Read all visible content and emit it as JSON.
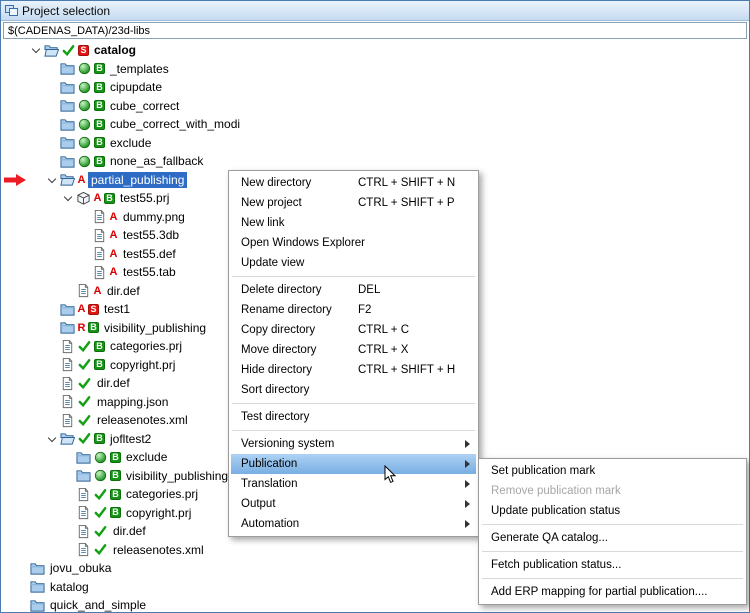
{
  "window": {
    "title": "Project selection",
    "path": "$(CADENAS_DATA)/23d-libs"
  },
  "tree": {
    "items": [
      {
        "depth": 0,
        "expander": "open",
        "bold": true,
        "icons": [
          {
            "t": "folder-open"
          },
          {
            "t": "check"
          },
          {
            "t": "badge",
            "letter": "S",
            "color": "red"
          }
        ],
        "label": "catalog"
      },
      {
        "depth": 1,
        "icons": [
          {
            "t": "folder"
          },
          {
            "t": "orb"
          },
          {
            "t": "badge",
            "letter": "B",
            "color": "green"
          }
        ],
        "label": "_templates"
      },
      {
        "depth": 1,
        "icons": [
          {
            "t": "folder"
          },
          {
            "t": "orb"
          },
          {
            "t": "badge",
            "letter": "B",
            "color": "green"
          }
        ],
        "label": "cipupdate"
      },
      {
        "depth": 1,
        "icons": [
          {
            "t": "folder"
          },
          {
            "t": "orb"
          },
          {
            "t": "badge",
            "letter": "B",
            "color": "green"
          }
        ],
        "label": "cube_correct"
      },
      {
        "depth": 1,
        "icons": [
          {
            "t": "folder"
          },
          {
            "t": "orb"
          },
          {
            "t": "badge",
            "letter": "B",
            "color": "green"
          }
        ],
        "label": "cube_correct_with_modi"
      },
      {
        "depth": 1,
        "icons": [
          {
            "t": "folder"
          },
          {
            "t": "orb"
          },
          {
            "t": "badge",
            "letter": "B",
            "color": "green"
          }
        ],
        "label": "exclude"
      },
      {
        "depth": 1,
        "icons": [
          {
            "t": "folder"
          },
          {
            "t": "orb"
          },
          {
            "t": "badge",
            "letter": "B",
            "color": "green"
          }
        ],
        "label": "none_as_fallback"
      },
      {
        "depth": 1,
        "expander": "open",
        "selected": true,
        "icons": [
          {
            "t": "folder-open"
          },
          {
            "t": "letter",
            "letter": "A"
          }
        ],
        "label": "partial_publishing"
      },
      {
        "depth": 2,
        "expander": "open",
        "icons": [
          {
            "t": "project"
          },
          {
            "t": "letter",
            "letter": "A"
          },
          {
            "t": "badge",
            "letter": "B",
            "color": "green"
          }
        ],
        "label": "test55.prj"
      },
      {
        "depth": 3,
        "icons": [
          {
            "t": "file"
          },
          {
            "t": "letter",
            "letter": "A"
          }
        ],
        "label": "dummy.png"
      },
      {
        "depth": 3,
        "icons": [
          {
            "t": "file"
          },
          {
            "t": "letter",
            "letter": "A"
          }
        ],
        "label": "test55.3db"
      },
      {
        "depth": 3,
        "icons": [
          {
            "t": "file"
          },
          {
            "t": "letter",
            "letter": "A"
          }
        ],
        "label": "test55.def"
      },
      {
        "depth": 3,
        "icons": [
          {
            "t": "file"
          },
          {
            "t": "letter",
            "letter": "A"
          }
        ],
        "label": "test55.tab"
      },
      {
        "depth": 2,
        "icons": [
          {
            "t": "file"
          },
          {
            "t": "letter",
            "letter": "A"
          }
        ],
        "label": "dir.def"
      },
      {
        "depth": 1,
        "icons": [
          {
            "t": "folder"
          },
          {
            "t": "letter",
            "letter": "A"
          },
          {
            "t": "badge",
            "letter": "S",
            "color": "red"
          }
        ],
        "label": "test1"
      },
      {
        "depth": 1,
        "icons": [
          {
            "t": "folder"
          },
          {
            "t": "letter",
            "letter": "R"
          },
          {
            "t": "badge",
            "letter": "B",
            "color": "green"
          }
        ],
        "label": "visibility_publishing"
      },
      {
        "depth": 1,
        "icons": [
          {
            "t": "file"
          },
          {
            "t": "check"
          },
          {
            "t": "badge",
            "letter": "B",
            "color": "green"
          }
        ],
        "label": "categories.prj"
      },
      {
        "depth": 1,
        "icons": [
          {
            "t": "file"
          },
          {
            "t": "check"
          },
          {
            "t": "badge",
            "letter": "B",
            "color": "green"
          }
        ],
        "label": "copyright.prj"
      },
      {
        "depth": 1,
        "icons": [
          {
            "t": "file"
          },
          {
            "t": "check"
          }
        ],
        "label": "dir.def"
      },
      {
        "depth": 1,
        "icons": [
          {
            "t": "file"
          },
          {
            "t": "check"
          }
        ],
        "label": "mapping.json"
      },
      {
        "depth": 1,
        "icons": [
          {
            "t": "file"
          },
          {
            "t": "check"
          }
        ],
        "label": "releasenotes.xml"
      },
      {
        "depth": 1,
        "expander": "open",
        "icons": [
          {
            "t": "folder-open"
          },
          {
            "t": "check"
          },
          {
            "t": "badge",
            "letter": "B",
            "color": "green"
          }
        ],
        "label": "jofltest2"
      },
      {
        "depth": 2,
        "icons": [
          {
            "t": "folder"
          },
          {
            "t": "orb"
          },
          {
            "t": "badge",
            "letter": "B",
            "color": "green"
          }
        ],
        "label": "exclude"
      },
      {
        "depth": 2,
        "icons": [
          {
            "t": "folder"
          },
          {
            "t": "orb"
          },
          {
            "t": "badge",
            "letter": "B",
            "color": "green"
          }
        ],
        "label": "visibility_publishing"
      },
      {
        "depth": 2,
        "icons": [
          {
            "t": "file"
          },
          {
            "t": "check"
          },
          {
            "t": "badge",
            "letter": "B",
            "color": "green"
          }
        ],
        "label": "categories.prj"
      },
      {
        "depth": 2,
        "icons": [
          {
            "t": "file"
          },
          {
            "t": "check"
          },
          {
            "t": "badge",
            "letter": "B",
            "color": "green"
          }
        ],
        "label": "copyright.prj"
      },
      {
        "depth": 2,
        "icons": [
          {
            "t": "file"
          },
          {
            "t": "check"
          }
        ],
        "label": "dir.def"
      },
      {
        "depth": 2,
        "icons": [
          {
            "t": "file"
          },
          {
            "t": "check"
          }
        ],
        "label": "releasenotes.xml"
      },
      {
        "depth": 0,
        "slot": false,
        "icons": [
          {
            "t": "folder"
          }
        ],
        "label": "jovu_obuka"
      },
      {
        "depth": 0,
        "slot": false,
        "icons": [
          {
            "t": "folder"
          }
        ],
        "label": "katalog"
      },
      {
        "depth": 0,
        "slot": false,
        "icons": [
          {
            "t": "folder"
          }
        ],
        "label": "quick_and_simple"
      }
    ]
  },
  "context_menu": {
    "items": [
      {
        "label": "New directory",
        "shortcut": "CTRL + SHIFT + N"
      },
      {
        "label": "New project",
        "shortcut": "CTRL + SHIFT + P"
      },
      {
        "label": "New link"
      },
      {
        "label": "Open Windows Explorer"
      },
      {
        "label": "Update view"
      },
      {
        "type": "separator"
      },
      {
        "label": "Delete directory",
        "shortcut": "DEL"
      },
      {
        "label": "Rename directory",
        "shortcut": "F2"
      },
      {
        "label": "Copy directory",
        "shortcut": "CTRL + C"
      },
      {
        "label": "Move directory",
        "shortcut": "CTRL + X"
      },
      {
        "label": "Hide directory",
        "shortcut": "CTRL + SHIFT + H"
      },
      {
        "label": "Sort directory"
      },
      {
        "type": "separator"
      },
      {
        "label": "Test directory"
      },
      {
        "type": "separator"
      },
      {
        "label": "Versioning system",
        "submenu": true
      },
      {
        "label": "Publication",
        "submenu": true,
        "highlighted": true
      },
      {
        "label": "Translation",
        "submenu": true
      },
      {
        "label": "Output",
        "submenu": true
      },
      {
        "label": "Automation",
        "submenu": true
      }
    ]
  },
  "submenu": {
    "items": [
      {
        "label": "Set publication mark"
      },
      {
        "label": "Remove publication mark",
        "disabled": true
      },
      {
        "label": "Update publication status"
      },
      {
        "type": "separator"
      },
      {
        "label": "Generate QA catalog..."
      },
      {
        "type": "separator"
      },
      {
        "label": "Fetch publication status..."
      },
      {
        "type": "separator"
      },
      {
        "label": "Add ERP mapping for partial publication...."
      }
    ]
  }
}
